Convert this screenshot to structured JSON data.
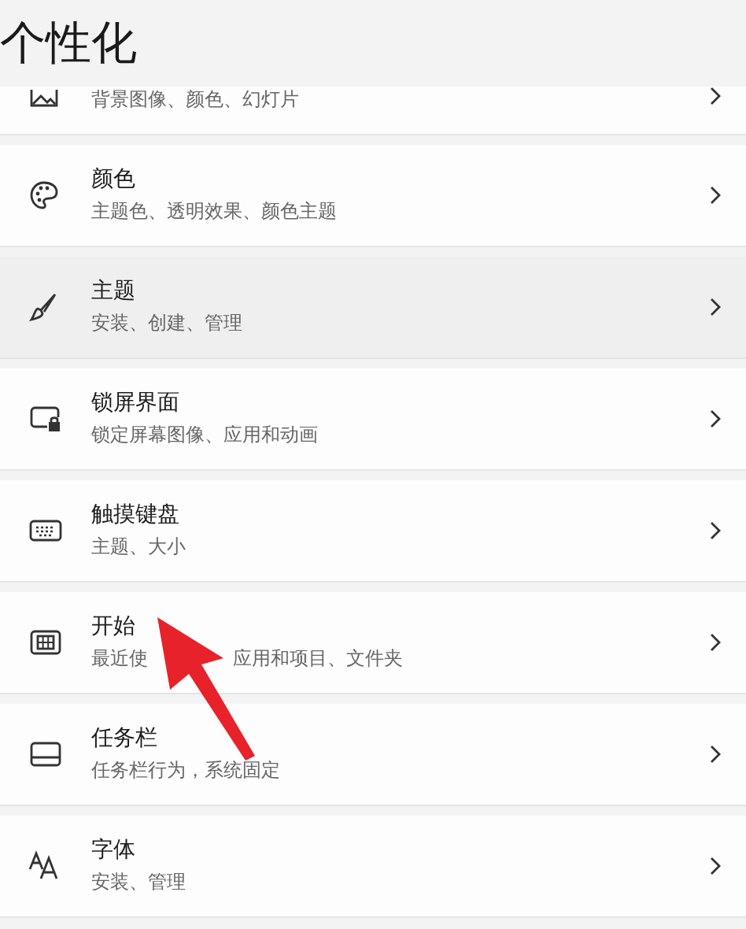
{
  "title": "个性化",
  "items": [
    {
      "kind": "cut",
      "subtitle": "背景图像、颜色、幻灯片",
      "hovered": false
    },
    {
      "kind": "full",
      "label": "颜色",
      "subtitle": "主题色、透明效果、颜色主题",
      "hovered": false
    },
    {
      "kind": "full",
      "label": "主题",
      "subtitle": "安装、创建、管理",
      "hovered": true
    },
    {
      "kind": "full",
      "label": "锁屏界面",
      "subtitle": "锁定屏幕图像、应用和动画",
      "hovered": false
    },
    {
      "kind": "full",
      "label": "触摸键盘",
      "subtitle": "主题、大小",
      "hovered": false
    },
    {
      "kind": "full",
      "label": "开始",
      "subtitle": "最近使",
      "subtitle_2": "应用和项目、文件夹",
      "hovered": false
    },
    {
      "kind": "full",
      "label": "任务栏",
      "subtitle": "任务栏行为，系统固定",
      "hovered": false
    },
    {
      "kind": "full",
      "label": "字体",
      "subtitle": "安装、管理",
      "hovered": false
    }
  ]
}
